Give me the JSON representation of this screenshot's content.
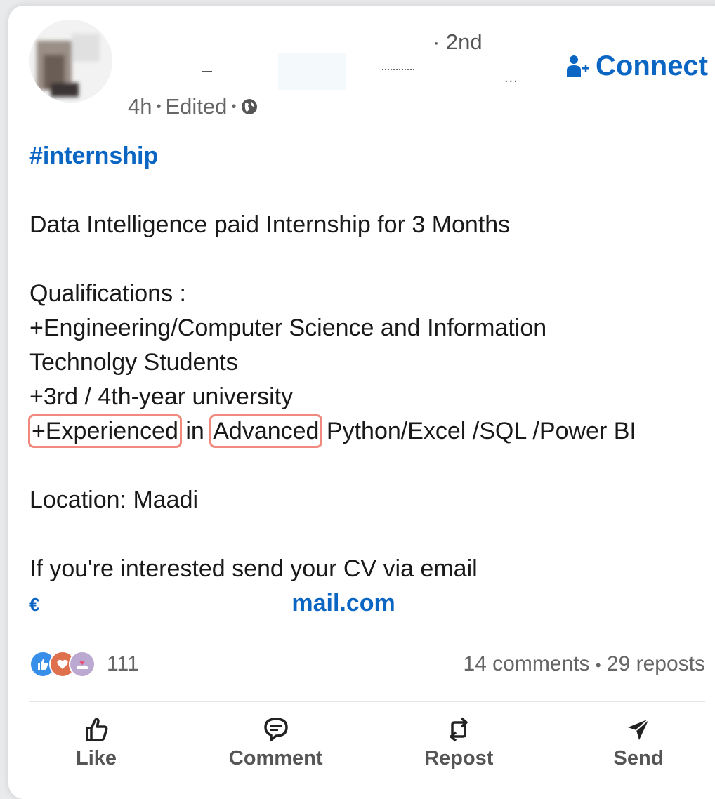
{
  "post": {
    "degree": "· 2nd",
    "more_dots": "...",
    "connect_label": "Connect",
    "meta": {
      "time": "4h",
      "sep1": "•",
      "edited": "Edited",
      "sep2": "•"
    },
    "hashtag": "#internship",
    "lines": {
      "title": "Data Intelligence paid Internship for 3 Months",
      "qual_header": "Qualifications :",
      "qual1": "+Engineering/Computer Science and Information",
      "qual1b": "Technolgy Students",
      "qual2": "+3rd / 4th-year university",
      "qual3_a": "+Experienced",
      "qual3_b": " in ",
      "qual3_c": "Advanced",
      "qual3_d": " Python/Excel /SQL /Power BI",
      "location": "Location: Maadi",
      "cta": "If you're interested send your CV via email",
      "email_prefix": "€",
      "email_suffix": "mail.com"
    },
    "reaction_count": "111",
    "comments": "14 comments",
    "stats_sep": "•",
    "reposts": "29 reposts",
    "actions": {
      "like": "Like",
      "comment": "Comment",
      "repost": "Repost",
      "send": "Send"
    }
  },
  "colors": {
    "accent": "#0a66c2",
    "highlight_box": "#f08a7e",
    "like_icon": "#378fe9",
    "love_icon": "#df704d",
    "support_icon": "#bba9d1"
  },
  "icons": {
    "connect": "person-add-icon",
    "visibility": "globe-icon",
    "like": "thumbs-up-icon",
    "comment": "speech-bubble-icon",
    "repost": "repost-arrows-icon",
    "send": "paper-plane-icon"
  }
}
